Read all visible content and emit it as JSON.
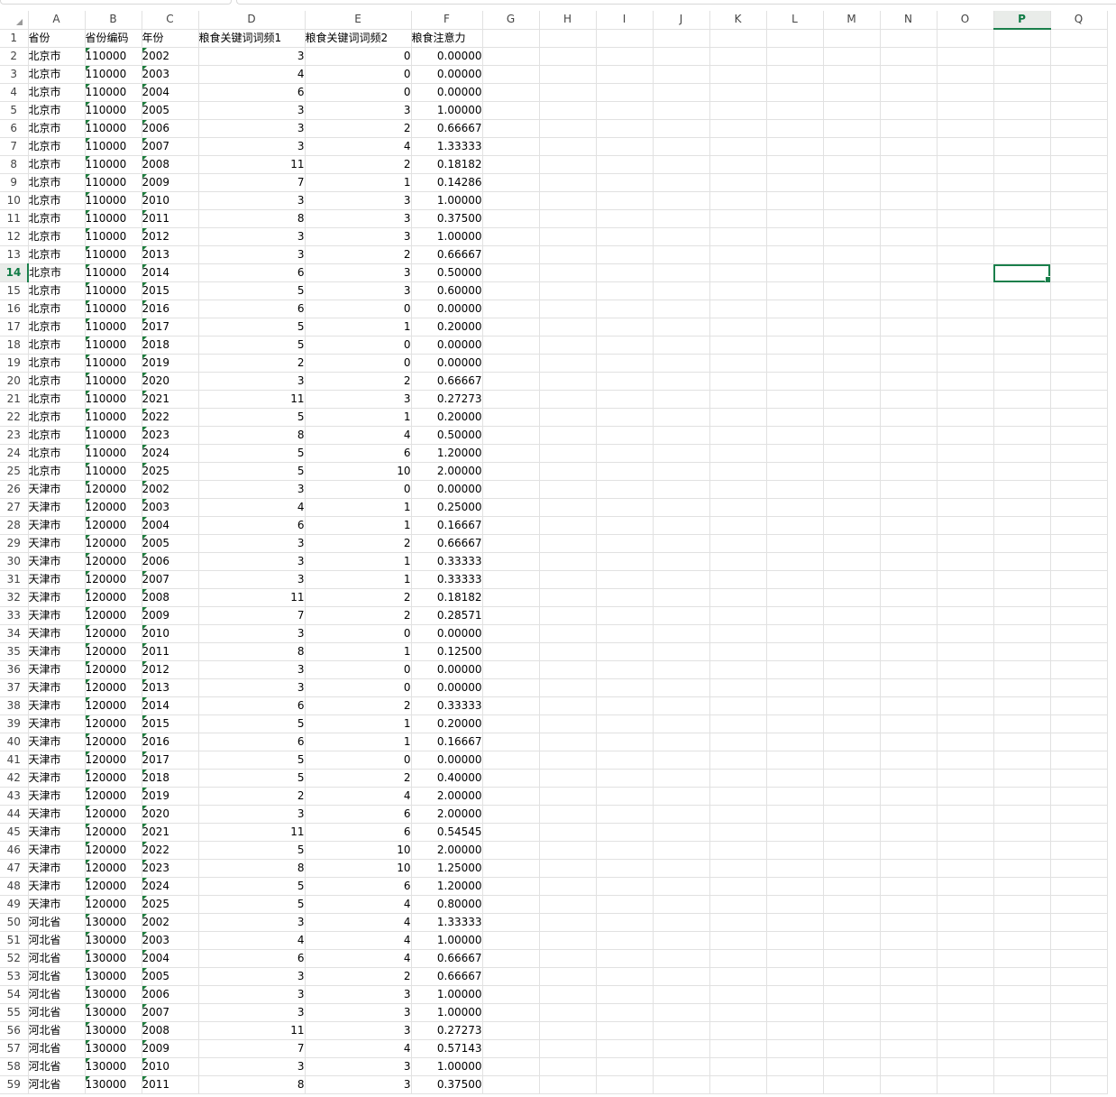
{
  "columns": [
    "A",
    "B",
    "C",
    "D",
    "E",
    "F",
    "G",
    "H",
    "I",
    "J",
    "K",
    "L",
    "M",
    "N",
    "O",
    "P",
    "Q"
  ],
  "selected_column": "P",
  "selected_row": 14,
  "selected_cell": "P14",
  "accent_color": "#1a7f4b",
  "header": [
    "省份",
    "省份编码",
    "年份",
    "粮食关键词词频1",
    "粮食关键词词频2",
    "粮食注意力"
  ],
  "rows": [
    [
      "北京市",
      "110000",
      "2002",
      "3",
      "0",
      "0.00000"
    ],
    [
      "北京市",
      "110000",
      "2003",
      "4",
      "0",
      "0.00000"
    ],
    [
      "北京市",
      "110000",
      "2004",
      "6",
      "0",
      "0.00000"
    ],
    [
      "北京市",
      "110000",
      "2005",
      "3",
      "3",
      "1.00000"
    ],
    [
      "北京市",
      "110000",
      "2006",
      "3",
      "2",
      "0.66667"
    ],
    [
      "北京市",
      "110000",
      "2007",
      "3",
      "4",
      "1.33333"
    ],
    [
      "北京市",
      "110000",
      "2008",
      "11",
      "2",
      "0.18182"
    ],
    [
      "北京市",
      "110000",
      "2009",
      "7",
      "1",
      "0.14286"
    ],
    [
      "北京市",
      "110000",
      "2010",
      "3",
      "3",
      "1.00000"
    ],
    [
      "北京市",
      "110000",
      "2011",
      "8",
      "3",
      "0.37500"
    ],
    [
      "北京市",
      "110000",
      "2012",
      "3",
      "3",
      "1.00000"
    ],
    [
      "北京市",
      "110000",
      "2013",
      "3",
      "2",
      "0.66667"
    ],
    [
      "北京市",
      "110000",
      "2014",
      "6",
      "3",
      "0.50000"
    ],
    [
      "北京市",
      "110000",
      "2015",
      "5",
      "3",
      "0.60000"
    ],
    [
      "北京市",
      "110000",
      "2016",
      "6",
      "0",
      "0.00000"
    ],
    [
      "北京市",
      "110000",
      "2017",
      "5",
      "1",
      "0.20000"
    ],
    [
      "北京市",
      "110000",
      "2018",
      "5",
      "0",
      "0.00000"
    ],
    [
      "北京市",
      "110000",
      "2019",
      "2",
      "0",
      "0.00000"
    ],
    [
      "北京市",
      "110000",
      "2020",
      "3",
      "2",
      "0.66667"
    ],
    [
      "北京市",
      "110000",
      "2021",
      "11",
      "3",
      "0.27273"
    ],
    [
      "北京市",
      "110000",
      "2022",
      "5",
      "1",
      "0.20000"
    ],
    [
      "北京市",
      "110000",
      "2023",
      "8",
      "4",
      "0.50000"
    ],
    [
      "北京市",
      "110000",
      "2024",
      "5",
      "6",
      "1.20000"
    ],
    [
      "北京市",
      "110000",
      "2025",
      "5",
      "10",
      "2.00000"
    ],
    [
      "天津市",
      "120000",
      "2002",
      "3",
      "0",
      "0.00000"
    ],
    [
      "天津市",
      "120000",
      "2003",
      "4",
      "1",
      "0.25000"
    ],
    [
      "天津市",
      "120000",
      "2004",
      "6",
      "1",
      "0.16667"
    ],
    [
      "天津市",
      "120000",
      "2005",
      "3",
      "2",
      "0.66667"
    ],
    [
      "天津市",
      "120000",
      "2006",
      "3",
      "1",
      "0.33333"
    ],
    [
      "天津市",
      "120000",
      "2007",
      "3",
      "1",
      "0.33333"
    ],
    [
      "天津市",
      "120000",
      "2008",
      "11",
      "2",
      "0.18182"
    ],
    [
      "天津市",
      "120000",
      "2009",
      "7",
      "2",
      "0.28571"
    ],
    [
      "天津市",
      "120000",
      "2010",
      "3",
      "0",
      "0.00000"
    ],
    [
      "天津市",
      "120000",
      "2011",
      "8",
      "1",
      "0.12500"
    ],
    [
      "天津市",
      "120000",
      "2012",
      "3",
      "0",
      "0.00000"
    ],
    [
      "天津市",
      "120000",
      "2013",
      "3",
      "0",
      "0.00000"
    ],
    [
      "天津市",
      "120000",
      "2014",
      "6",
      "2",
      "0.33333"
    ],
    [
      "天津市",
      "120000",
      "2015",
      "5",
      "1",
      "0.20000"
    ],
    [
      "天津市",
      "120000",
      "2016",
      "6",
      "1",
      "0.16667"
    ],
    [
      "天津市",
      "120000",
      "2017",
      "5",
      "0",
      "0.00000"
    ],
    [
      "天津市",
      "120000",
      "2018",
      "5",
      "2",
      "0.40000"
    ],
    [
      "天津市",
      "120000",
      "2019",
      "2",
      "4",
      "2.00000"
    ],
    [
      "天津市",
      "120000",
      "2020",
      "3",
      "6",
      "2.00000"
    ],
    [
      "天津市",
      "120000",
      "2021",
      "11",
      "6",
      "0.54545"
    ],
    [
      "天津市",
      "120000",
      "2022",
      "5",
      "10",
      "2.00000"
    ],
    [
      "天津市",
      "120000",
      "2023",
      "8",
      "10",
      "1.25000"
    ],
    [
      "天津市",
      "120000",
      "2024",
      "5",
      "6",
      "1.20000"
    ],
    [
      "天津市",
      "120000",
      "2025",
      "5",
      "4",
      "0.80000"
    ],
    [
      "河北省",
      "130000",
      "2002",
      "3",
      "4",
      "1.33333"
    ],
    [
      "河北省",
      "130000",
      "2003",
      "4",
      "4",
      "1.00000"
    ],
    [
      "河北省",
      "130000",
      "2004",
      "6",
      "4",
      "0.66667"
    ],
    [
      "河北省",
      "130000",
      "2005",
      "3",
      "2",
      "0.66667"
    ],
    [
      "河北省",
      "130000",
      "2006",
      "3",
      "3",
      "1.00000"
    ],
    [
      "河北省",
      "130000",
      "2007",
      "3",
      "3",
      "1.00000"
    ],
    [
      "河北省",
      "130000",
      "2008",
      "11",
      "3",
      "0.27273"
    ],
    [
      "河北省",
      "130000",
      "2009",
      "7",
      "4",
      "0.57143"
    ],
    [
      "河北省",
      "130000",
      "2010",
      "3",
      "3",
      "1.00000"
    ],
    [
      "河北省",
      "130000",
      "2011",
      "8",
      "3",
      "0.37500"
    ]
  ]
}
